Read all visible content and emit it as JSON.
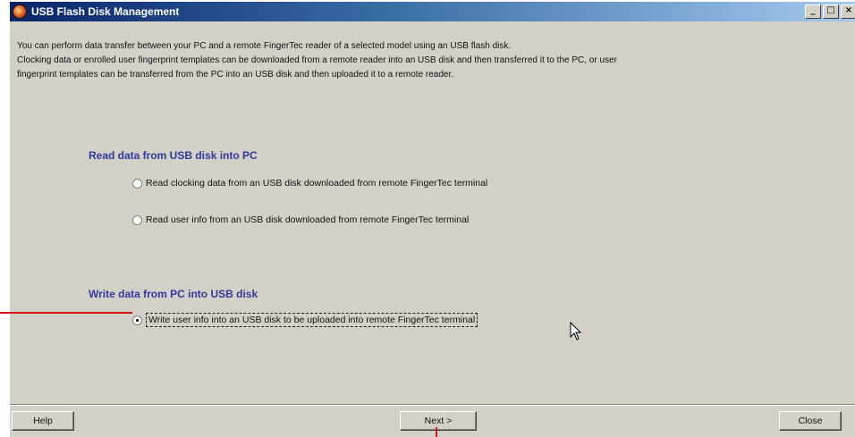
{
  "window": {
    "title": "USB Flash Disk Management",
    "controls": {
      "minimize": "_",
      "maximize": "□",
      "close": "×"
    }
  },
  "description": {
    "line1": "You can perform data transfer between your PC and a remote FingerTec reader of a selected model using an USB flash disk.",
    "line2": "Clocking data or enrolled user fingerprint templates can be downloaded from a remote reader into an USB disk and then transferred it to the PC, or user",
    "line3": "fingerprint templates can be transferred from the PC into an USB disk and then uploaded it to a remote reader."
  },
  "read_section": {
    "title": "Read data from USB disk into PC",
    "option1": "Read clocking data from an USB disk downloaded from remote FingerTec terminal",
    "option2": "Read user info from an USB disk downloaded from remote FingerTec terminal"
  },
  "write_section": {
    "title": "Write data from PC into USB disk",
    "option1": "Write user info into an USB disk to be uploaded into remote FingerTec terminal",
    "selected": true
  },
  "buttons": {
    "help": "Help",
    "next": "Next >",
    "close": "Close"
  },
  "colors": {
    "section_title": "#2d3b9c",
    "dialog_bg": "#d4d0c8",
    "annotation": "#d01818"
  }
}
